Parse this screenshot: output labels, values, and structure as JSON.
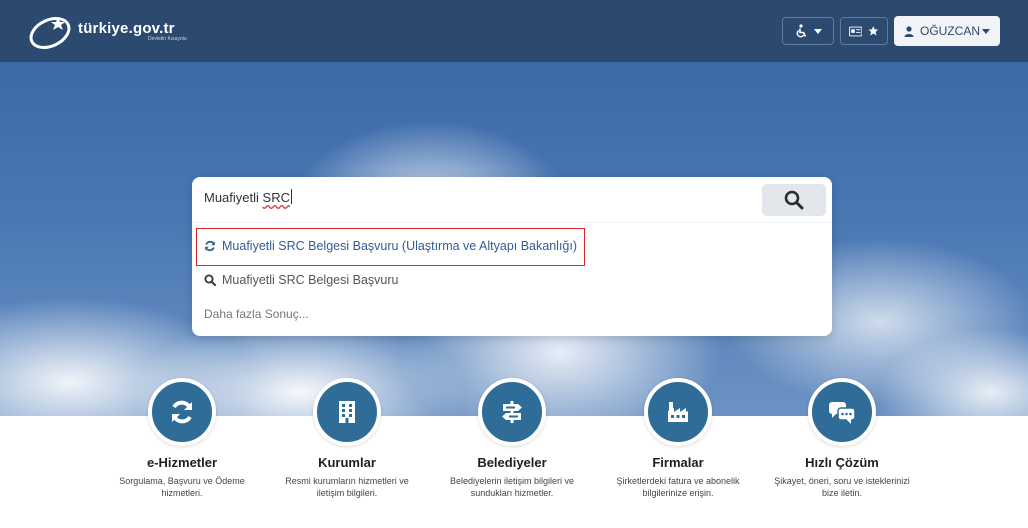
{
  "header": {
    "logo_title": "türkiye.gov.tr",
    "logo_subtitle": "Devletin Kısayolu",
    "user_name": "OĞUZCAN",
    "icons": [
      "accessibility-icon",
      "id-card-icon",
      "star-icon",
      "user-icon"
    ]
  },
  "search": {
    "query_prefix": "Muafiyetli ",
    "query_highlight": "SRC",
    "suggestions": [
      {
        "icon": "refresh-icon",
        "text": "Muafiyetli SRC Belgesi Başvuru (Ulaştırma ve Altyapı Bakanlığı)"
      },
      {
        "icon": "search-icon",
        "text": "Muafiyetli SRC Belgesi Başvuru"
      }
    ],
    "more": "Daha fazla Sonuç..."
  },
  "categories": [
    {
      "icon": "refresh-icon",
      "title": "e-Hizmetler",
      "desc": "Sorgulama, Başvuru ve Ödeme hizmetleri."
    },
    {
      "icon": "building-icon",
      "title": "Kurumlar",
      "desc": "Resmi kurumların hizmetleri ve iletişim bilgileri."
    },
    {
      "icon": "signpost-icon",
      "title": "Belediyeler",
      "desc": "Belediyelerin iletişim bilgileri ve sundukları hizmetler."
    },
    {
      "icon": "factory-icon",
      "title": "Firmalar",
      "desc": "Şirketlerdeki fatura ve abonelik bilgilerinize erişin."
    },
    {
      "icon": "chat-icon",
      "title": "Hızlı Çözüm",
      "desc": "Şikayet, öneri, soru ve isteklerinizi bize iletin."
    }
  ],
  "colors": {
    "header": "#2c4a70",
    "accent": "#2f6c98",
    "link": "#2f5d96",
    "highlight_border": "#d8262b"
  }
}
